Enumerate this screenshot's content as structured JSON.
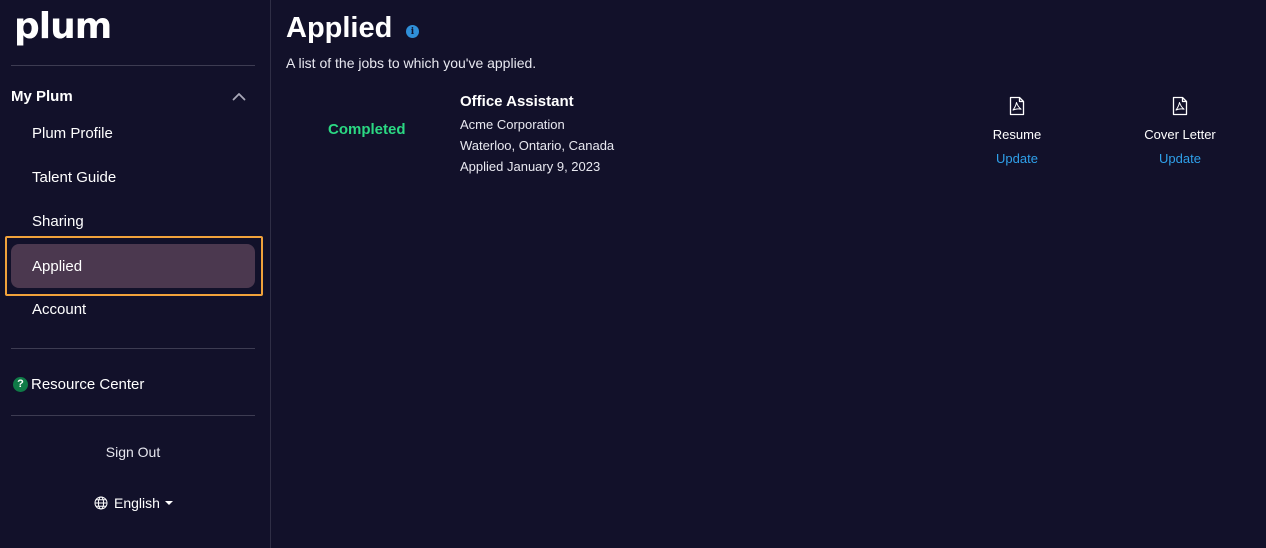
{
  "app": {
    "logo": "plum"
  },
  "sidebar": {
    "section_title": "My Plum",
    "items": [
      {
        "label": "Plum Profile",
        "active": false
      },
      {
        "label": "Talent Guide",
        "active": false
      },
      {
        "label": "Sharing",
        "active": false
      },
      {
        "label": "Applied",
        "active": true
      },
      {
        "label": "Account",
        "active": false
      }
    ],
    "resource_center": "Resource Center",
    "sign_out": "Sign Out",
    "language": "English"
  },
  "main": {
    "title": "Applied",
    "subtitle": "A list of the jobs to which you've applied.",
    "applications": [
      {
        "status": "Completed",
        "job_title": "Office Assistant",
        "company": "Acme Corporation",
        "location": "Waterloo, Ontario, Canada",
        "applied": "Applied January 9, 2023",
        "documents": [
          {
            "label": "Resume",
            "action": "Update"
          },
          {
            "label": "Cover Letter",
            "action": "Update"
          }
        ]
      }
    ]
  },
  "colors": {
    "background": "#12112a",
    "active_item": "#4b384f",
    "focus_ring": "#f1a23b",
    "status_completed": "#2bd883",
    "link": "#2fa0ea",
    "info": "#2f8fd8",
    "help_icon": "#0f7a47"
  },
  "icons": {
    "info": "info-icon",
    "help": "question-circle-icon",
    "chevron": "chevron-up-icon",
    "language": "globe-icon",
    "document": "pdf-file-icon"
  }
}
